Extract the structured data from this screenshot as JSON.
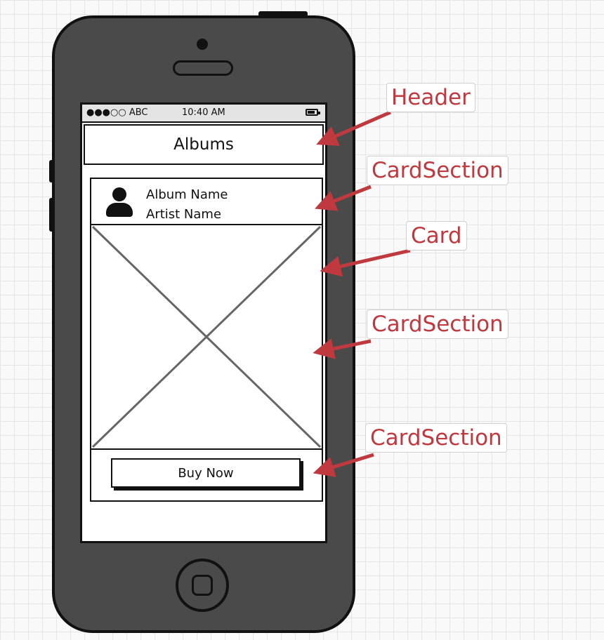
{
  "statusbar": {
    "carrier": "●●●○○ ABC",
    "time": "10:40 AM"
  },
  "header": {
    "title": "Albums"
  },
  "card": {
    "album_name": "Album Name",
    "artist_name": "Artist Name",
    "button_label": "Buy Now"
  },
  "annotations": {
    "header": "Header",
    "card_section_1": "CardSection",
    "card": "Card",
    "card_section_2": "CardSection",
    "card_section_3": "CardSection"
  },
  "colors": {
    "annotation": "#c0393f",
    "phone_body": "#4a4a4a"
  },
  "icons": [
    "avatar-icon",
    "battery-icon",
    "image-placeholder-icon",
    "home-icon"
  ]
}
